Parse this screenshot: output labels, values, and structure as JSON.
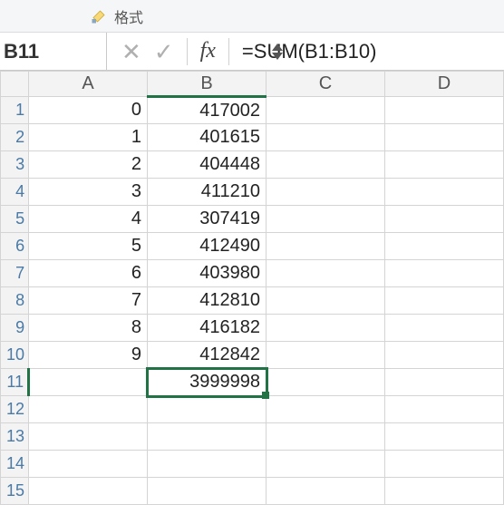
{
  "ribbon": {
    "format_label": "格式"
  },
  "formula_bar": {
    "cell_ref": "B11",
    "fx_symbol": "fx",
    "formula": "=SUM(B1:B10)"
  },
  "columns": [
    "A",
    "B",
    "C",
    "D"
  ],
  "row_headers": [
    "1",
    "2",
    "3",
    "4",
    "5",
    "6",
    "7",
    "8",
    "9",
    "10",
    "11",
    "12",
    "13",
    "14",
    "15"
  ],
  "selected_cell": "B11",
  "chart_data": {
    "type": "table",
    "title": "",
    "columns": [
      "A",
      "B"
    ],
    "rows": [
      {
        "A": 0,
        "B": 417002
      },
      {
        "A": 1,
        "B": 401615
      },
      {
        "A": 2,
        "B": 404448
      },
      {
        "A": 3,
        "B": 411210
      },
      {
        "A": 4,
        "B": 307419
      },
      {
        "A": 5,
        "B": 412490
      },
      {
        "A": 6,
        "B": 403980
      },
      {
        "A": 7,
        "B": 412810
      },
      {
        "A": 8,
        "B": 416182
      },
      {
        "A": 9,
        "B": 412842
      }
    ],
    "sum_B": 3999998
  }
}
